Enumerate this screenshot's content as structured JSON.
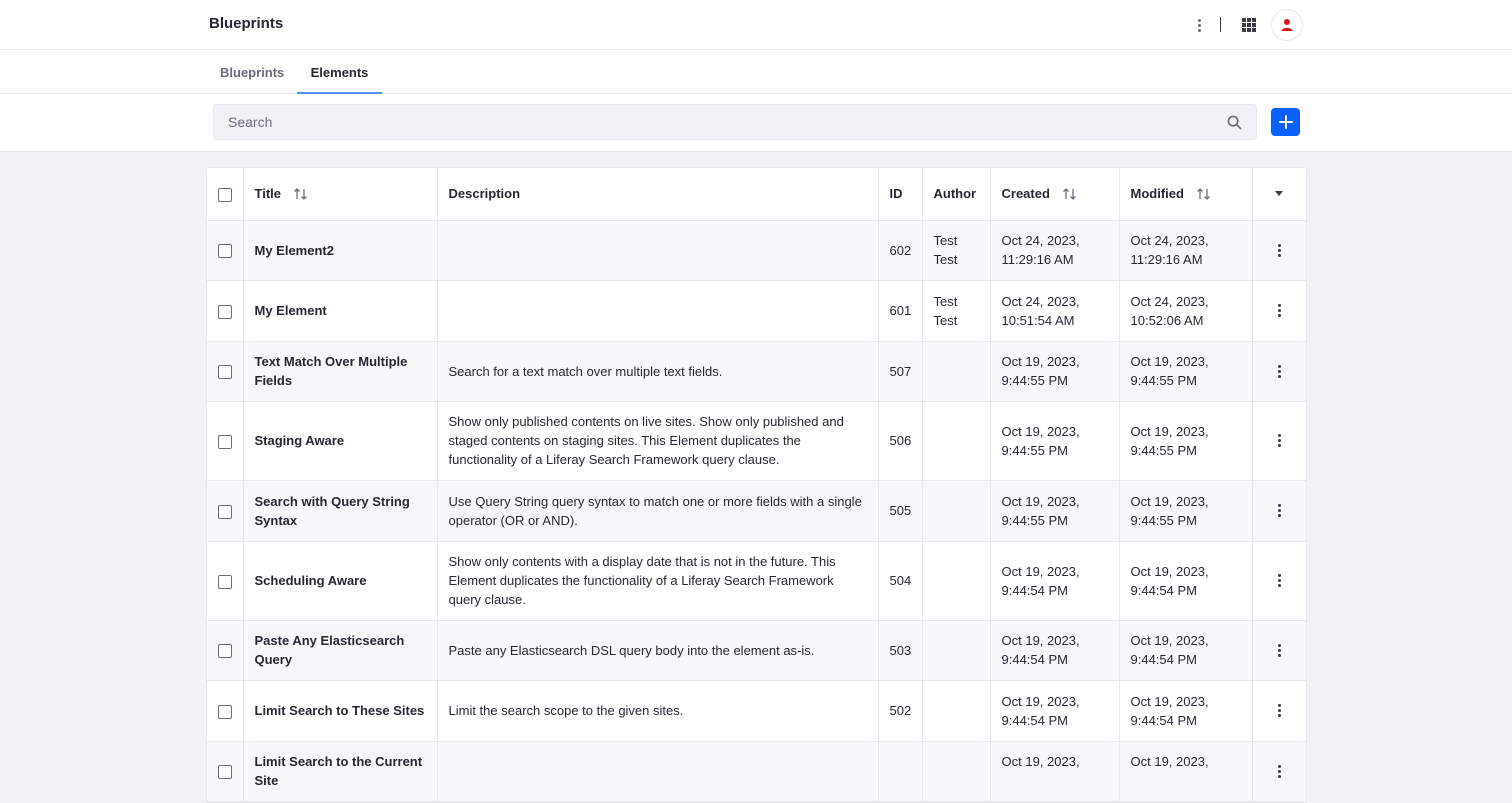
{
  "header": {
    "app_title": "Blueprints",
    "icons": [
      "kebab-menu-icon",
      "apps-grid-icon",
      "user-avatar-icon"
    ]
  },
  "tabs": [
    {
      "label": "Blueprints",
      "active": false
    },
    {
      "label": "Elements",
      "active": true
    }
  ],
  "toolbar": {
    "search_placeholder": "Search",
    "search_value": "",
    "add_button_icon": "plus-icon",
    "accent_color": "#0b5fff"
  },
  "table": {
    "columns": {
      "title": "Title",
      "description": "Description",
      "id": "ID",
      "author": "Author",
      "created": "Created",
      "modified": "Modified"
    },
    "rows": [
      {
        "title": "My Element2",
        "description": "",
        "id": "602",
        "author": "Test Test",
        "created": "Oct 24, 2023, 11:29:16 AM",
        "modified": "Oct 24, 2023, 11:29:16 AM"
      },
      {
        "title": "My Element",
        "description": "",
        "id": "601",
        "author": "Test Test",
        "created": "Oct 24, 2023, 10:51:54 AM",
        "modified": "Oct 24, 2023, 10:52:06 AM"
      },
      {
        "title": "Text Match Over Multiple Fields",
        "description": "Search for a text match over multiple text fields.",
        "id": "507",
        "author": "",
        "created": "Oct 19, 2023, 9:44:55 PM",
        "modified": "Oct 19, 2023, 9:44:55 PM"
      },
      {
        "title": "Staging Aware",
        "description": "Show only published contents on live sites. Show only published and staged contents on staging sites. This Element duplicates the functionality of a Liferay Search Framework query clause.",
        "id": "506",
        "author": "",
        "created": "Oct 19, 2023, 9:44:55 PM",
        "modified": "Oct 19, 2023, 9:44:55 PM"
      },
      {
        "title": "Search with Query String Syntax",
        "description": "Use Query String query syntax to match one or more fields with a single operator (OR or AND).",
        "id": "505",
        "author": "",
        "created": "Oct 19, 2023, 9:44:55 PM",
        "modified": "Oct 19, 2023, 9:44:55 PM"
      },
      {
        "title": "Scheduling Aware",
        "description": "Show only contents with a display date that is not in the future. This Element duplicates the functionality of a Liferay Search Framework query clause.",
        "id": "504",
        "author": "",
        "created": "Oct 19, 2023, 9:44:54 PM",
        "modified": "Oct 19, 2023, 9:44:54 PM"
      },
      {
        "title": "Paste Any Elasticsearch Query",
        "description": "Paste any Elasticsearch DSL query body into the element as-is.",
        "id": "503",
        "author": "",
        "created": "Oct 19, 2023, 9:44:54 PM",
        "modified": "Oct 19, 2023, 9:44:54 PM"
      },
      {
        "title": "Limit Search to These Sites",
        "description": "Limit the search scope to the given sites.",
        "id": "502",
        "author": "",
        "created": "Oct 19, 2023, 9:44:54 PM",
        "modified": "Oct 19, 2023, 9:44:54 PM"
      },
      {
        "title": "Limit Search to the Current Site",
        "description": "",
        "id": "",
        "author": "",
        "created": "Oct 19, 2023,",
        "modified": "Oct 19, 2023,"
      }
    ]
  }
}
